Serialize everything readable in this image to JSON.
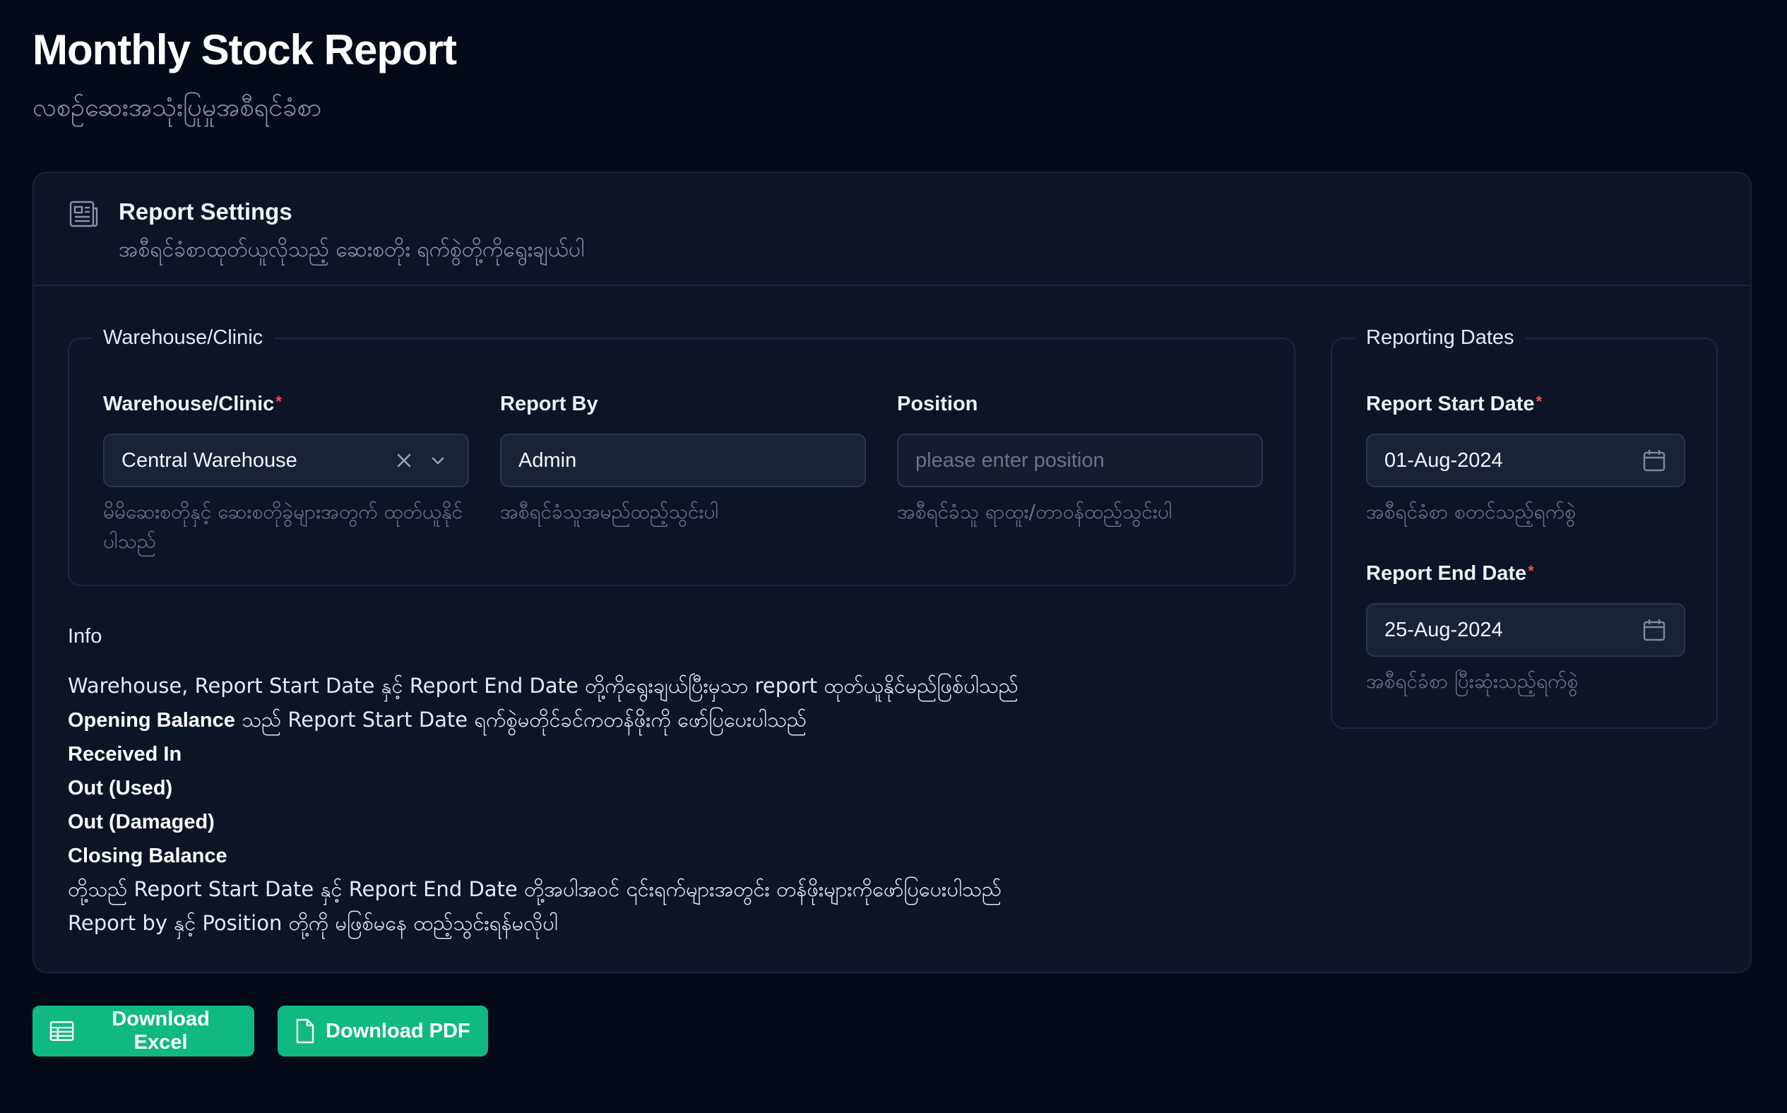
{
  "header": {
    "title": "Monthly Stock Report",
    "subtitle": "လစဉ်ဆေးအသုံးပြုမှုအစီရင်ခံစာ"
  },
  "settings": {
    "title": "Report Settings",
    "subtitle": "အစီရင်ခံစာထုတ်ယူလိုသည့် ဆေးစတိုး ရက်စွဲတို့ကိုရွေးချယ်ပါ",
    "icon": "report-icon"
  },
  "warehouse_group": {
    "legend": "Warehouse/Clinic",
    "warehouse": {
      "label": "Warehouse/Clinic",
      "required": "*",
      "value": "Central Warehouse",
      "help": "မိမိဆေးစတိုနှင့် ဆေးစတိုခွဲများအတွက် ထုတ်ယူနိုင်ပါသည်"
    },
    "report_by": {
      "label": "Report By",
      "value": "Admin",
      "help": "အစီရင်ခံသူအမည်ထည့်သွင်းပါ"
    },
    "position": {
      "label": "Position",
      "value": "",
      "placeholder": "please enter position",
      "help": "အစီရင်ခံသူ ရာထူး/တာဝန်ထည့်သွင်းပါ"
    }
  },
  "dates_group": {
    "legend": "Reporting Dates",
    "start": {
      "label": "Report Start Date",
      "required": "*",
      "value": "01-Aug-2024",
      "help": "အစီရင်ခံစာ စတင်သည့်ရက်စွဲ"
    },
    "end": {
      "label": "Report End Date",
      "required": "*",
      "value": "25-Aug-2024",
      "help": "အစီရင်ခံစာ ပြီးဆုံးသည့်ရက်စွဲ"
    }
  },
  "info": {
    "title": "Info",
    "line1": "Warehouse, Report Start Date နှင့် Report End Date တို့ကိုရွေးချယ်ပြီးမှသာ report ထုတ်ယူနိုင်မည်ဖြစ်ပါသည်",
    "opening_bold": "Opening Balance",
    "opening_rest": " သည် Report Start Date ရက်စွဲမတိုင်ခင်ကတန်ဖိုးကို ဖော်ပြပေးပါသည်",
    "received": "Received In",
    "out_used": "Out (Used)",
    "out_damaged": "Out (Damaged)",
    "closing": "Closing Balance",
    "line7": "တို့သည် Report Start Date နှင့် Report End Date တို့အပါအဝင် ၎င်းရက်များအတွင်း တန်ဖိုးများကိုဖော်ပြပေးပါသည်",
    "line8": "Report by နှင့် Position တို့ကို မဖြစ်မနေ ထည့်သွင်းရန်မလိုပါ"
  },
  "actions": {
    "excel_label": "Download Excel",
    "pdf_label": "Download PDF"
  },
  "colors": {
    "background": "#050a19",
    "card": "#0c1426",
    "accent": "#10b981",
    "required": "#f05252"
  }
}
